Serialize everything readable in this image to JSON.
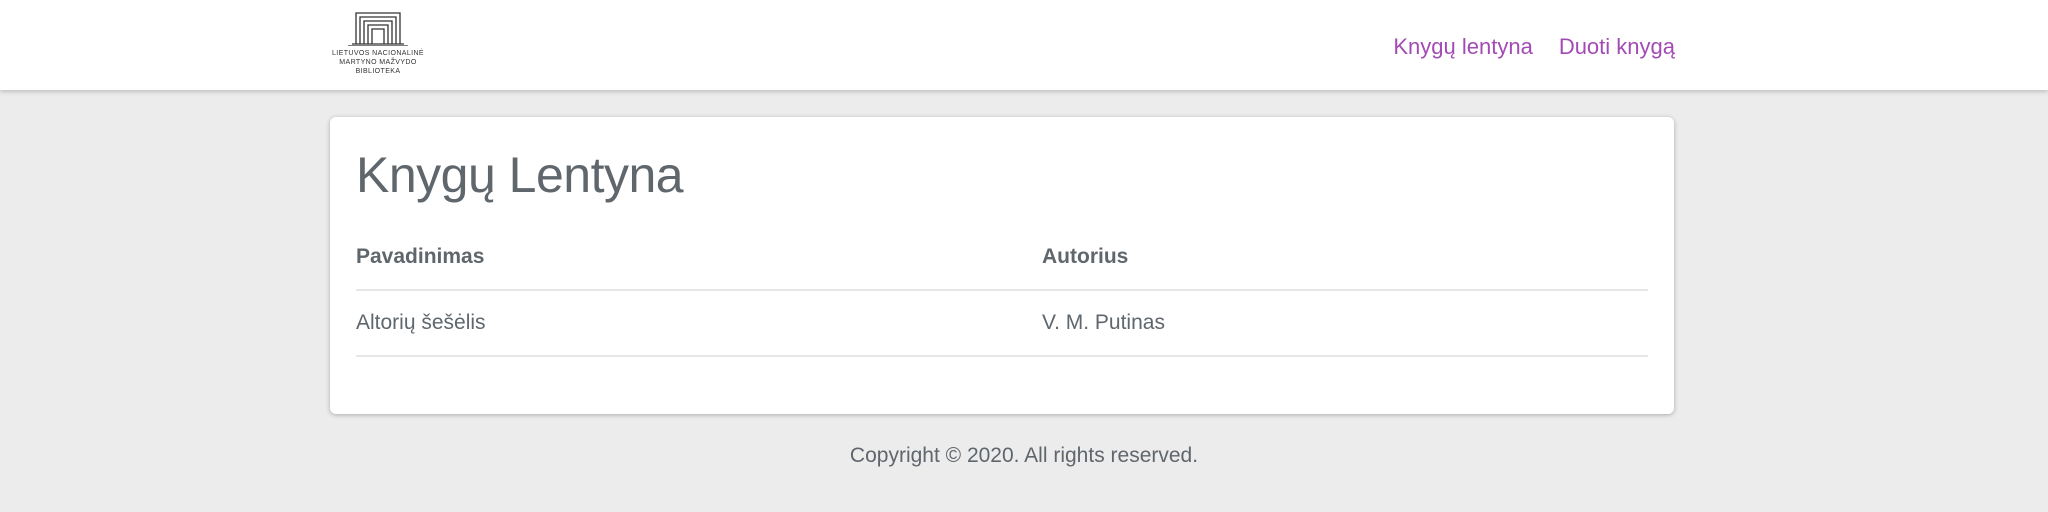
{
  "header": {
    "logo_lines": [
      "LIETUVOS NACIONALINĖ",
      "MARTYNO MAŽVYDO",
      "BIBLIOTEKA"
    ],
    "nav": [
      {
        "label": "Knygų lentyna"
      },
      {
        "label": "Duoti knygą"
      }
    ]
  },
  "main": {
    "title": "Knygų Lentyna",
    "table": {
      "columns": [
        "Pavadinimas",
        "Autorius"
      ],
      "rows": [
        {
          "title": "Altorių šešėlis",
          "author": "V. M. Putinas"
        }
      ]
    }
  },
  "footer": {
    "text": "Copyright © 2020. All rights reserved."
  },
  "colors": {
    "background": "#ececed",
    "nav_link": "#a24bb4",
    "text": "#5f666c"
  }
}
